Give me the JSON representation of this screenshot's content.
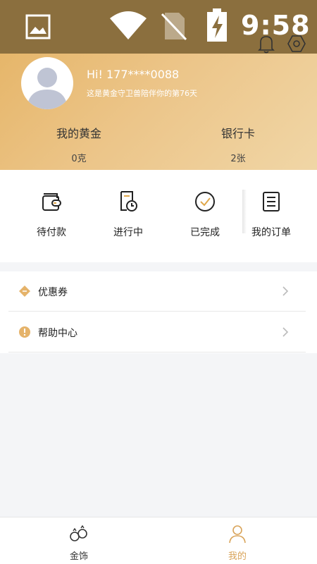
{
  "status_bar": {
    "time": "9:58",
    "icons": [
      "gallery-icon",
      "wifi-icon",
      "no-sim-icon",
      "battery-charging-icon"
    ]
  },
  "header": {
    "greeting": "Hi!  177****0088",
    "subtitle": "这是黄金守卫兽陪伴你的第76天",
    "icons": [
      "bell-icon",
      "settings-icon"
    ],
    "stats": [
      {
        "label": "我的黄金",
        "value": "0克"
      },
      {
        "label": "银行卡",
        "value": "2张"
      }
    ]
  },
  "orders": {
    "items": [
      {
        "label": "待付款",
        "icon": "wallet-icon"
      },
      {
        "label": "进行中",
        "icon": "clock-doc-icon"
      },
      {
        "label": "已完成",
        "icon": "check-circle-icon"
      },
      {
        "label": "我的订单",
        "icon": "order-list-icon"
      }
    ]
  },
  "menu": {
    "items": [
      {
        "label": "优惠券",
        "icon": "coupon-icon"
      },
      {
        "label": "帮助中心",
        "icon": "help-icon"
      }
    ]
  },
  "tabbar": {
    "items": [
      {
        "label": "金饰",
        "icon": "rings-icon"
      },
      {
        "label": "我的",
        "icon": "person-icon",
        "active": true
      }
    ]
  },
  "colors": {
    "accent": "#d9a45a",
    "header_gradient_start": "#e6b66a",
    "header_gradient_end": "#f0d6a6",
    "status_bar": "#8b6f3e"
  }
}
